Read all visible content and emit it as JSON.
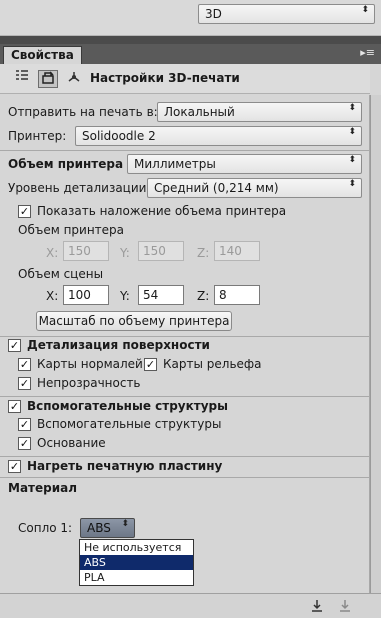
{
  "top": {
    "workspace_select": "3D",
    "arrow": "⬍"
  },
  "panel": {
    "tab_label": "Свойства",
    "menu_icon": "▸≡",
    "header_title": "Настройки 3D-печати",
    "header_icons": [
      "scene-list-icon",
      "print-settings-icon",
      "3d-axis-icon"
    ]
  },
  "print": {
    "send_label": "Отправить на печать в:",
    "send_value": "Локальный",
    "printer_label": "Принтер:",
    "printer_value": "Solidoodle 2"
  },
  "volume": {
    "title": "Объем принтера",
    "units_value": "Миллиметры",
    "detail_label": "Уровень детализации:",
    "detail_value": "Средний (0,214 мм)",
    "show_overlay_label": "Показать наложение объема принтера",
    "show_overlay_checked": true,
    "printer_volume_label": "Объем принтера",
    "printer_x_label": "X:",
    "printer_x": "150",
    "printer_y_label": "Y:",
    "printer_y": "150",
    "printer_z_label": "Z:",
    "printer_z": "140",
    "scene_volume_label": "Объем сцены",
    "scene_x_label": "X:",
    "scene_x": "100",
    "scene_y_label": "Y:",
    "scene_y": "54",
    "scene_z_label": "Z:",
    "scene_z": "8",
    "scale_button": "Масштаб по объему принтера"
  },
  "surface": {
    "title": "Детализация поверхности",
    "normal_maps": "Карты нормалей",
    "bump_maps": "Карты рельефа",
    "opacity": "Непрозрачность"
  },
  "support": {
    "title": "Вспомогательные структуры",
    "structures": "Вспомогательные структуры",
    "base": "Основание"
  },
  "heat": {
    "title": "Нагреть печатную пластину"
  },
  "material": {
    "title": "Материал",
    "nozzle_label": "Сопло 1:",
    "nozzle_value": "ABS",
    "options": [
      "Не используется",
      "ABS",
      "PLA"
    ],
    "selected_index": 1
  },
  "check_mark": "✓"
}
